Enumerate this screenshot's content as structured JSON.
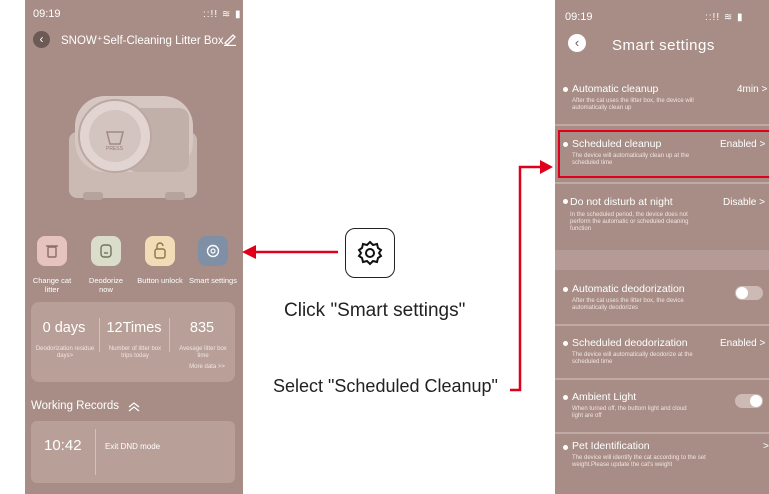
{
  "left_phone": {
    "status_time": "09:19",
    "status_icons": "::!! ≋ ▮",
    "device_title": "SNOW⁺Self-Cleaning Litter Box",
    "product_badge": "PRESS",
    "actions": [
      {
        "label": "Change cat litter",
        "icon": "trash-icon",
        "color": "#e6c3bf"
      },
      {
        "label": "Deodorize now",
        "icon": "deodorize-icon",
        "color": "#d9ddc9"
      },
      {
        "label": "Button unlock",
        "icon": "unlock-icon",
        "color": "#f0ddb8"
      },
      {
        "label": "Smart settings",
        "icon": "gear-icon",
        "color": "#7f90a6"
      }
    ],
    "stats": [
      {
        "value": "0 days",
        "label": "Deodorization residue days>"
      },
      {
        "value": "12Times",
        "label": "Number of litter box trips today"
      },
      {
        "value": "835",
        "label": "Avesage litter box time"
      }
    ],
    "more_data": "More data >>",
    "records_title": "Working Records",
    "record": {
      "time": "10:42",
      "text": "Exit DND mode"
    }
  },
  "middle": {
    "caption_1": "Click \"Smart settings\"",
    "caption_2": "Select \"Scheduled Cleanup\"",
    "arrow_color": "#e0001b"
  },
  "right_phone": {
    "status_time": "09:19",
    "status_icons": "::!! ≋ ▮",
    "title": "Smart settings",
    "rows": [
      {
        "title": "Automatic cleanup",
        "value": "4min >",
        "desc": "After the cat uses the litter box, the device will automatically clean up"
      },
      {
        "title": "Scheduled cleanup",
        "value": "Enabled >",
        "desc": "The device will automatically clean up at the scheduled time"
      },
      {
        "title": "Do not disturb at night",
        "value": "Disable >",
        "desc": "In the scheduled period, the device does not perform the automatic or scheduled cleaning function"
      },
      {
        "title": "Automatic deodorization",
        "value": "",
        "desc": "After the cat uses the litter box, the device automatically deodorizes"
      },
      {
        "title": "Scheduled deodorization",
        "value": "Enabled >",
        "desc": "The device will automatically deodorize at the scheduled time"
      },
      {
        "title": "Ambient Light",
        "value": "",
        "desc": "When turned off, the buttom light and cloud light are off"
      },
      {
        "title": "Pet Identification",
        "value": ">",
        "desc": "The device will identify the cat according to the set weight.Please update the cat's weight"
      }
    ]
  }
}
